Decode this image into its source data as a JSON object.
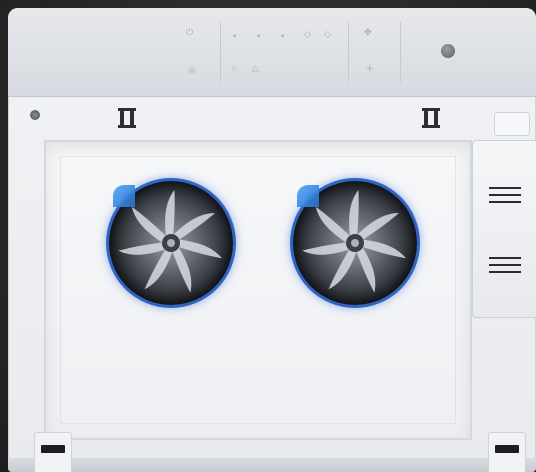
{
  "device": {
    "brand_text": "",
    "panel_icons": [
      "power-icon",
      "mode-icon",
      "dot-icon",
      "dot-icon",
      "dot-icon",
      "diamond-icon",
      "diamond-icon",
      "fan-speed-icon",
      "plus-icon",
      "power-button-icon"
    ],
    "fans": [
      {
        "name": "left-fan",
        "accent_color": "#2c64c8"
      },
      {
        "name": "right-fan",
        "accent_color": "#2c64c8"
      }
    ]
  },
  "colors": {
    "body": "#eceef1",
    "panel": "#dde0e5",
    "fan_ring": "#2c64c8",
    "background": "#1e1e1e"
  }
}
